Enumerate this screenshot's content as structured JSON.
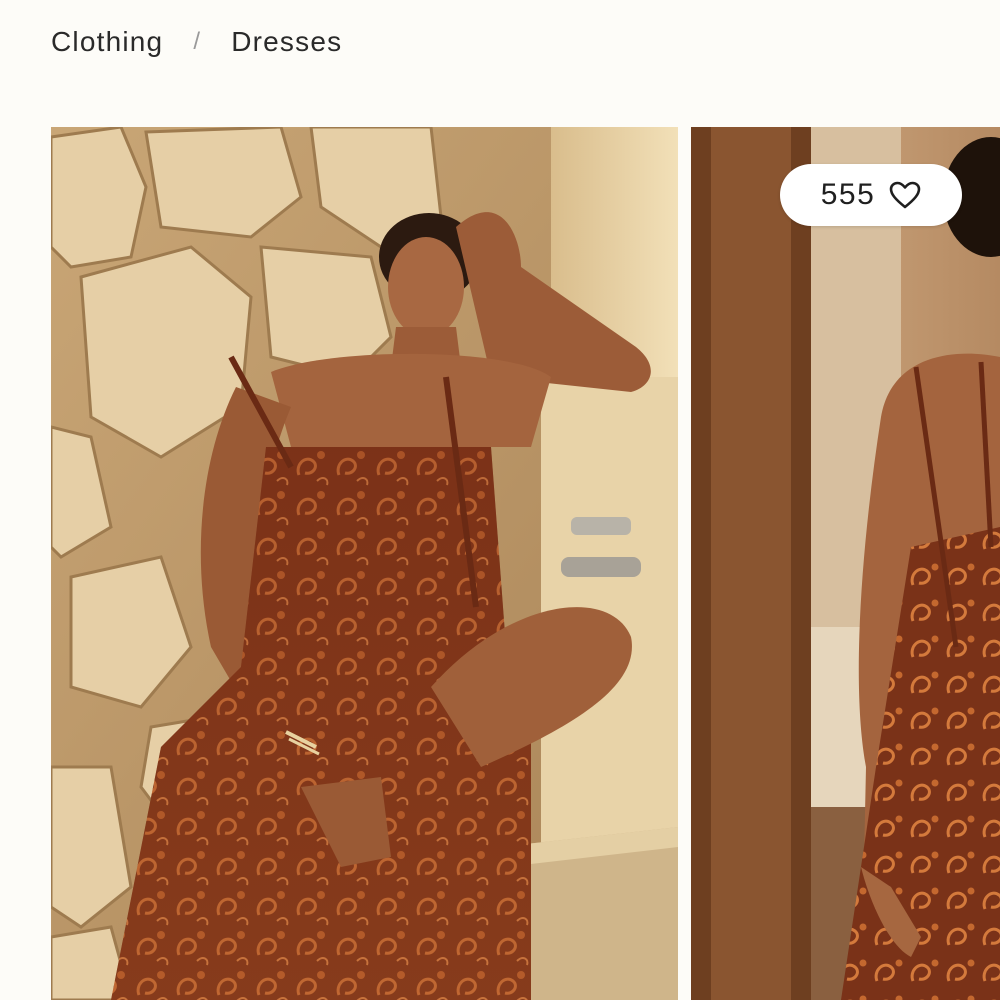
{
  "breadcrumb": {
    "items": [
      {
        "label": "Clothing"
      },
      {
        "label": "Dresses"
      }
    ],
    "separator": "/"
  },
  "gallery": {
    "images": [
      {
        "name": "product-image-front",
        "icon": "photo-model-seated-paisley-dress"
      },
      {
        "name": "product-image-back",
        "icon": "photo-model-back-view-dress"
      }
    ]
  },
  "favorites": {
    "count": "555",
    "icon": "heart-outline-icon"
  },
  "colors": {
    "background": "#fdfcf8",
    "text": "#2a2a2a",
    "dress": "#8a3a1c",
    "stone": "#d8b98a"
  }
}
